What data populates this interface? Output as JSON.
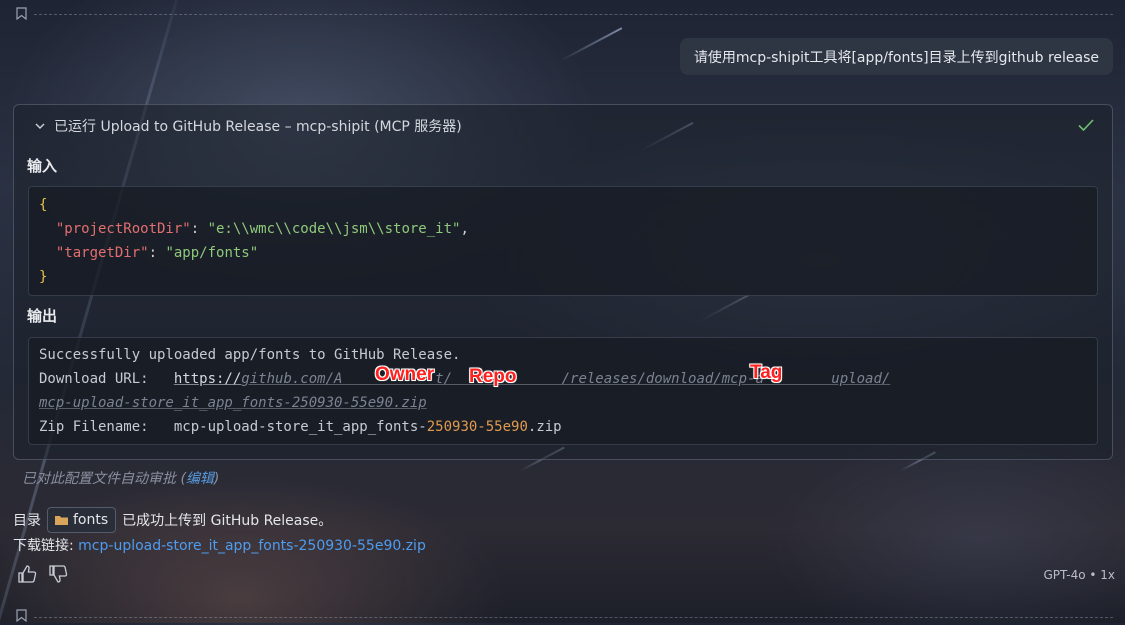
{
  "user_message": "请使用mcp-shipit工具将[app/fonts]目录上传到github release",
  "tool_call": {
    "header": "已运行 Upload to GitHub Release – mcp-shipit (MCP 服务器)",
    "input_label": "输入",
    "output_label": "输出",
    "input_json": {
      "open_brace": "{",
      "close_brace": "}",
      "line1_key": "\"projectRootDir\"",
      "line1_value": "\"e:\\\\wmc\\\\code\\\\jsm\\\\store_it\"",
      "line2_key": "\"targetDir\"",
      "line2_value": "\"app/fonts\""
    },
    "output": {
      "line1": "Successfully uploaded app/fonts to GitHub Release.",
      "url_label": "Download URL:   ",
      "url_prefix": "https://",
      "url_middle": "github.com/A           t/             /releases/download/mcp-a        upload/",
      "url_cont": "mcp-upload-store_it_app_fonts-250930-55e90.zip",
      "zip_label": "Zip Filename:   ",
      "zip_name_a": "mcp-upload-store_it_app_fonts-",
      "zip_name_num": "250930-55e90",
      "zip_name_ext": ".zip"
    }
  },
  "annotations": {
    "owner": "Owner",
    "repo": "Repo",
    "tag": "Tag"
  },
  "auto_approve": {
    "text": "已对此配置文件自动审批 (",
    "link": "编辑",
    "close": ")"
  },
  "answer": {
    "prefix": "目录",
    "chip_label": "fonts",
    "suffix": "已成功上传到 GitHub Release。",
    "download_label": "下载链接: ",
    "download_link": "mcp-upload-store_it_app_fonts-250930-55e90.zip"
  },
  "model": "GPT-4o • 1x",
  "icons": [
    "bookmark-icon",
    "chevron-down-icon",
    "check-icon",
    "folder-icon",
    "thumbs-up-icon",
    "thumbs-down-icon"
  ],
  "colors": {
    "json_key": "#e26f6f",
    "json_string": "#8fc97a",
    "json_brace": "#e3c44a",
    "link": "#4e9cf0",
    "success_check": "#6cc070",
    "annotation": "#ff2020"
  }
}
